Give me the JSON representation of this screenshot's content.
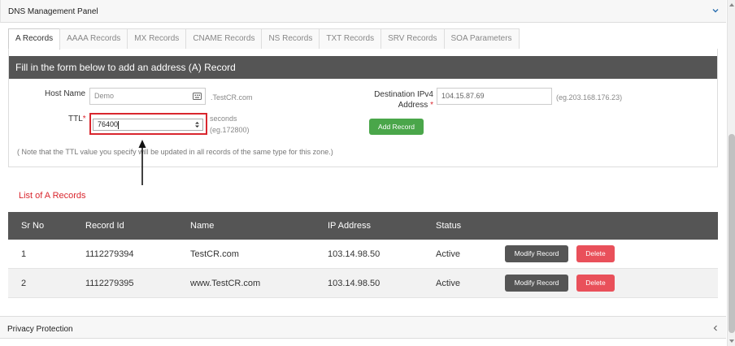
{
  "panel": {
    "title": "DNS Management Panel"
  },
  "tabs": [
    {
      "label": "A Records"
    },
    {
      "label": "AAAA Records"
    },
    {
      "label": "MX Records"
    },
    {
      "label": "CNAME Records"
    },
    {
      "label": "NS Records"
    },
    {
      "label": "TXT Records"
    },
    {
      "label": "SRV Records"
    },
    {
      "label": "SOA Parameters"
    }
  ],
  "form": {
    "heading": "Fill in the form below to add an address (A) Record",
    "host_label": "Host Name",
    "host_value": "Demo",
    "host_suffix": ".TestCR.com",
    "ttl_label": "TTL",
    "ttl_value": "76400",
    "ttl_unit": "seconds",
    "ttl_example": "(eg.172800)",
    "dest_label_line1": "Destination IPv4",
    "dest_label_line2": "Address",
    "dest_value": "104.15.87.69",
    "dest_example": "(eg.203.168.176.23)",
    "required_mark": "*",
    "add_button": "Add Record",
    "note": "( Note that the TTL value you specify will be updated in all records of the same type for this zone.)"
  },
  "list": {
    "title": "List of A Records",
    "columns": [
      "Sr No",
      "Record Id",
      "Name",
      "IP Address",
      "Status"
    ],
    "rows": [
      {
        "sr": "1",
        "id": "1112279394",
        "name": "TestCR.com",
        "ip": "103.14.98.50",
        "status": "Active"
      },
      {
        "sr": "2",
        "id": "1112279395",
        "name": "www.TestCR.com",
        "ip": "103.14.98.50",
        "status": "Active"
      }
    ],
    "modify_label": "Modify Record",
    "delete_label": "Delete"
  },
  "footer": {
    "title": "Privacy Protection"
  },
  "icons": {
    "panel_toggle": "chevron-down-icon",
    "footer_toggle": "chevron-left-icon",
    "host_field": "keyboard-icon",
    "ttl_field": "spinner-icon"
  },
  "colors": {
    "accent_red": "#d9262e",
    "add_green": "#4aa64a",
    "delete_red": "#e9505a",
    "dark_header": "#555555",
    "chevron_blue": "#2a6fb0"
  }
}
